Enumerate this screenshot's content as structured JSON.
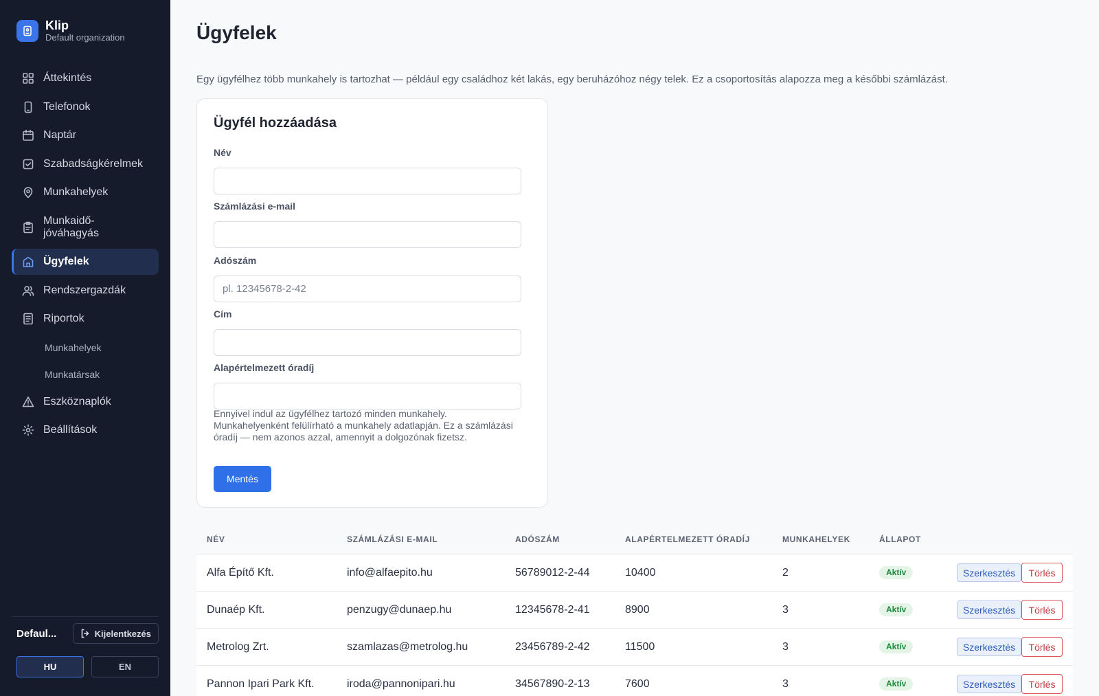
{
  "brand": {
    "name": "Klip",
    "org": "Default organization",
    "logo_icon": "badge-icon"
  },
  "nav": {
    "items": [
      {
        "label": "Áttekintés",
        "icon": "dashboard-icon"
      },
      {
        "label": "Telefonok",
        "icon": "phone-icon"
      },
      {
        "label": "Naptár",
        "icon": "calendar-icon"
      },
      {
        "label": "Szabadságkérelmek",
        "icon": "checkbox-icon"
      },
      {
        "label": "Munkahelyek",
        "icon": "map-pin-icon"
      },
      {
        "label": "Munkaidő-jóváhagyás",
        "icon": "clipboard-icon"
      },
      {
        "label": "Ügyfelek",
        "icon": "building-icon",
        "active": true
      },
      {
        "label": "Rendszergazdák",
        "icon": "users-icon"
      },
      {
        "label": "Riportok",
        "icon": "report-icon"
      }
    ],
    "sub_items": [
      "Munkahelyek",
      "Munkatársak"
    ],
    "items_after": [
      {
        "label": "Eszköznaplók",
        "icon": "warning-icon"
      },
      {
        "label": "Beállítások",
        "icon": "gear-icon"
      }
    ]
  },
  "footer": {
    "user": "Defaul...",
    "logout_label": "Kijelentkezés",
    "languages": [
      {
        "label": "HU",
        "active": true
      },
      {
        "label": "EN",
        "active": false
      }
    ]
  },
  "page": {
    "title": "Ügyfelek",
    "intro": "Egy ügyfélhez több munkahely is tartozhat — például egy családhoz két lakás, egy beruházóhoz négy telek. Ez a csoportosítás alapozza meg a későbbi számlázást."
  },
  "form": {
    "title": "Ügyfél hozzáadása",
    "fields": [
      {
        "label": "Név",
        "value": "",
        "placeholder": ""
      },
      {
        "label": "Számlázási e-mail",
        "value": "",
        "placeholder": ""
      },
      {
        "label": "Adószám",
        "value": "",
        "placeholder": "pl. 12345678-2-42"
      },
      {
        "label": "Cím",
        "value": "",
        "placeholder": ""
      },
      {
        "label": "Alapértelmezett óradíj",
        "value": "",
        "placeholder": ""
      }
    ],
    "help": "Ennyivel indul az ügyfélhez tartozó minden munkahely. Munkahelyenként felülírható a munkahely adatlapján. Ez a számlázási óradíj — nem azonos azzal, amennyit a dolgozónak fizetsz.",
    "save_label": "Mentés",
    "accent_color": "#2f6fe8"
  },
  "table": {
    "headers": [
      "NÉV",
      "SZÁMLÁZÁSI E-MAIL",
      "ADÓSZÁM",
      "ALAPÉRTELMEZETT ÓRADÍJ",
      "MUNKAHELYEK",
      "ÁLLAPOT"
    ],
    "edit_label": "Szerkesztés",
    "delete_label": "Törlés",
    "rows": [
      {
        "name": "Alfa Építő Kft.",
        "email": "info@alfaepito.hu",
        "tax": "56789012-2-44",
        "rate": "10400",
        "sites": "2",
        "status": "Aktív"
      },
      {
        "name": "Dunaép Kft.",
        "email": "penzugy@dunaep.hu",
        "tax": "12345678-2-41",
        "rate": "8900",
        "sites": "3",
        "status": "Aktív"
      },
      {
        "name": "Metrolog Zrt.",
        "email": "szamlazas@metrolog.hu",
        "tax": "23456789-2-42",
        "rate": "11500",
        "sites": "3",
        "status": "Aktív"
      },
      {
        "name": "Pannon Ipari Park Kft.",
        "email": "iroda@pannonipari.hu",
        "tax": "34567890-2-13",
        "rate": "7600",
        "sites": "3",
        "status": "Aktív"
      }
    ]
  },
  "colors": {
    "sidebar_bg": "#161b2c",
    "active_bg": "#212e4e",
    "status_green": "#1e8a3c",
    "danger": "#c43c40"
  }
}
